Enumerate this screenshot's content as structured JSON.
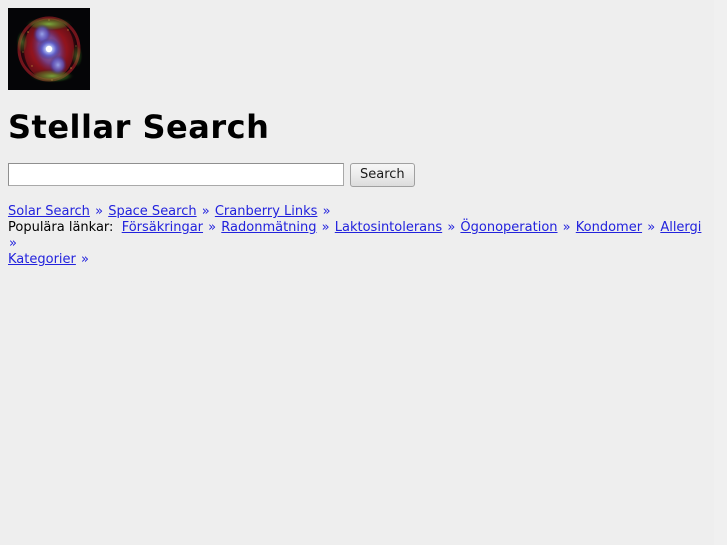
{
  "page": {
    "background_color": "#eeeeee",
    "link_color": "#2222dd",
    "text_color": "#000000"
  },
  "logo": {
    "name": "cats-eye-nebula-image",
    "alt": "Cat's Eye Nebula"
  },
  "header": {
    "title": "Stellar Search"
  },
  "search": {
    "value": "",
    "placeholder": "",
    "button_label": "Search"
  },
  "separator": "»",
  "nav": {
    "primary_links": [
      "Solar Search",
      "Space Search",
      "Cranberry Links"
    ],
    "popular_label": "Populära länkar:",
    "popular_links": [
      "Försäkringar",
      "Radonmätning",
      "Laktosintolerans",
      "Ögonoperation",
      "Kondomer",
      "Allergi"
    ],
    "categories_link": "Kategorier"
  }
}
